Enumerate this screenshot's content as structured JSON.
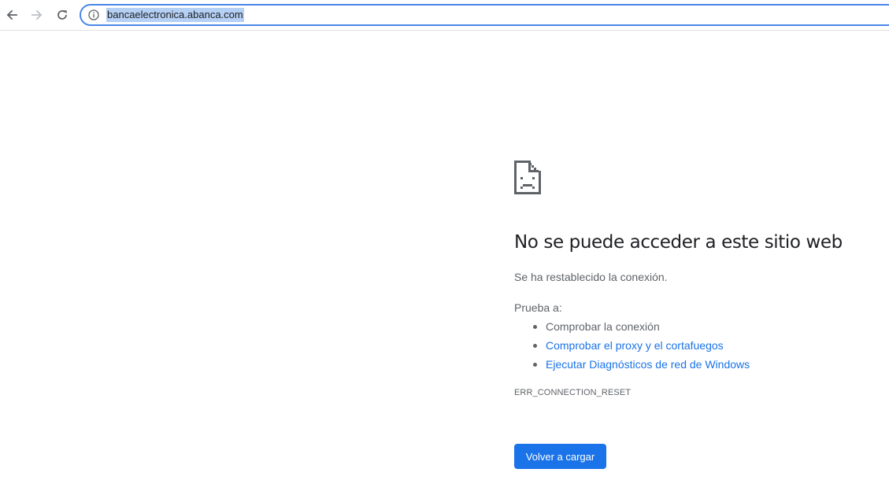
{
  "browser": {
    "url": "bancaelectronica.abanca.com",
    "back_icon": "back-arrow-icon",
    "forward_icon": "forward-arrow-icon",
    "reload_icon": "reload-icon",
    "site_info_icon": "info-icon"
  },
  "error_page": {
    "icon": "sad-document-icon",
    "heading": "No se puede acceder a este sitio web",
    "subtext": "Se ha restablecido la conexión.",
    "try_label": "Prueba a:",
    "suggestions": [
      {
        "label": "Comprobar la conexión",
        "is_link": false
      },
      {
        "label": "Comprobar el proxy y el cortafuegos",
        "is_link": true
      },
      {
        "label": "Ejecutar Diagnósticos de red de Windows",
        "is_link": true
      }
    ],
    "error_code": "ERR_CONNECTION_RESET",
    "reload_button_label": "Volver a cargar"
  },
  "colors": {
    "link": "#1a73e8",
    "button_bg": "#1a73e8",
    "omnibox_focus_border": "#4a86e8",
    "url_selection": "#b5d0f5"
  }
}
